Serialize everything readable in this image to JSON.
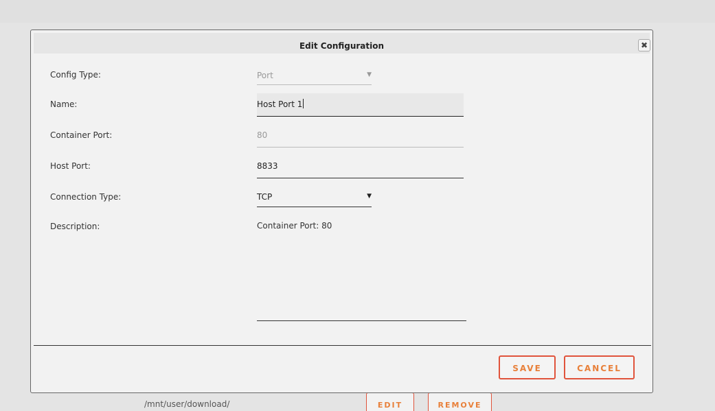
{
  "background": {
    "path_text": "/mnt/user/download/",
    "edit_label": "EDIT",
    "remove_label": "REMOVE"
  },
  "dialog": {
    "title": "Edit Configuration",
    "close_icon": "close-icon",
    "fields": {
      "config_type": {
        "label": "Config Type:",
        "value": "Port"
      },
      "name": {
        "label": "Name:",
        "value": "Host Port 1"
      },
      "container_port": {
        "label": "Container Port:",
        "value": "80"
      },
      "host_port": {
        "label": "Host Port:",
        "value": "8833"
      },
      "connection_type": {
        "label": "Connection Type:",
        "value": "TCP"
      },
      "description": {
        "label": "Description:",
        "value": "Container Port: 80"
      }
    },
    "buttons": {
      "save": "SAVE",
      "cancel": "CANCEL"
    }
  },
  "colors": {
    "accent_border": "#e0533b",
    "accent_text": "#e8803a",
    "dialog_bg": "#f2f2f2"
  }
}
